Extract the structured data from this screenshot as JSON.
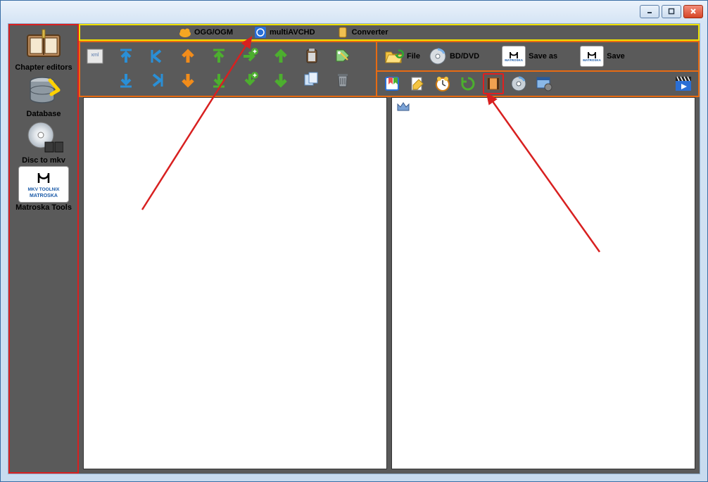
{
  "titlebar": {},
  "sidebar": {
    "items": [
      {
        "label": "Chapter editors",
        "icon": "book-open-icon"
      },
      {
        "label": "Database",
        "icon": "database-icon"
      },
      {
        "label": "Disc to mkv",
        "icon": "disc-icon"
      },
      {
        "label": "Matroska Tools",
        "icon": "matroska-icon"
      }
    ]
  },
  "tabs": [
    {
      "label": "OGG/OGM",
      "icon": "cloud-icon"
    },
    {
      "label": "multiAVCHD",
      "icon": "bluray-icon"
    },
    {
      "label": "Converter",
      "icon": "converter-icon"
    }
  ],
  "left_toolbar": [
    "xml-icon",
    "move-up-blue",
    "nav-left-blue",
    "arrow-up-orange",
    "arrow-up-green",
    "add-right-green",
    "arrow-up-green2",
    "clipboard-icon",
    "tag-icon",
    "",
    "move-down-blue",
    "nav-right-blue",
    "arrow-down-orange",
    "arrow-down-green",
    "add-down-green",
    "arrow-down-green2",
    "copy-icon",
    "trash-icon"
  ],
  "right_top": [
    {
      "label": "File",
      "icon": "folder-open-icon"
    },
    {
      "label": "BD/DVD",
      "icon": "disc-small-icon"
    },
    {
      "label": "Save as",
      "icon": "matroska-small-icon"
    },
    {
      "label": "Save",
      "icon": "matroska-small-icon"
    }
  ],
  "right_bottom_icons": [
    "bookmark-icon",
    "edit-note-icon",
    "clock-icon",
    "refresh-icon",
    "film-icon",
    "disc-small-icon",
    "window-gear-icon"
  ],
  "right_bottom_end_icon": "clapper-play-icon",
  "panel_decor_icon": "crown-icon",
  "matroska_text1": "MKV TOOLNIX",
  "matroska_text2": "MATROSKA"
}
